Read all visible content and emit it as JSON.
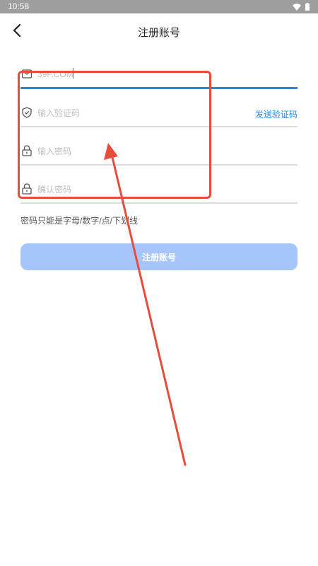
{
  "status_bar": {
    "time": "10:58",
    "wifi_icon": "wifi-icon",
    "battery_icon": "battery-icon"
  },
  "header": {
    "title": "注册账号",
    "back_icon": "chevron-left-icon"
  },
  "form": {
    "email": {
      "value": "",
      "placeholder": "39F.COM"
    },
    "code": {
      "placeholder": "输入验证码",
      "send_label": "发送验证码"
    },
    "password": {
      "placeholder": "输入密码"
    },
    "confirm": {
      "placeholder": "确认密码"
    },
    "hint": "密码只能是字母/数字/点/下划线",
    "submit_label": "注册账号"
  },
  "colors": {
    "accent": "#1e88e5",
    "button_disabled": "#a6c5fa",
    "annotation": "#e74c3c",
    "statusbar": "#9e9e9e"
  }
}
